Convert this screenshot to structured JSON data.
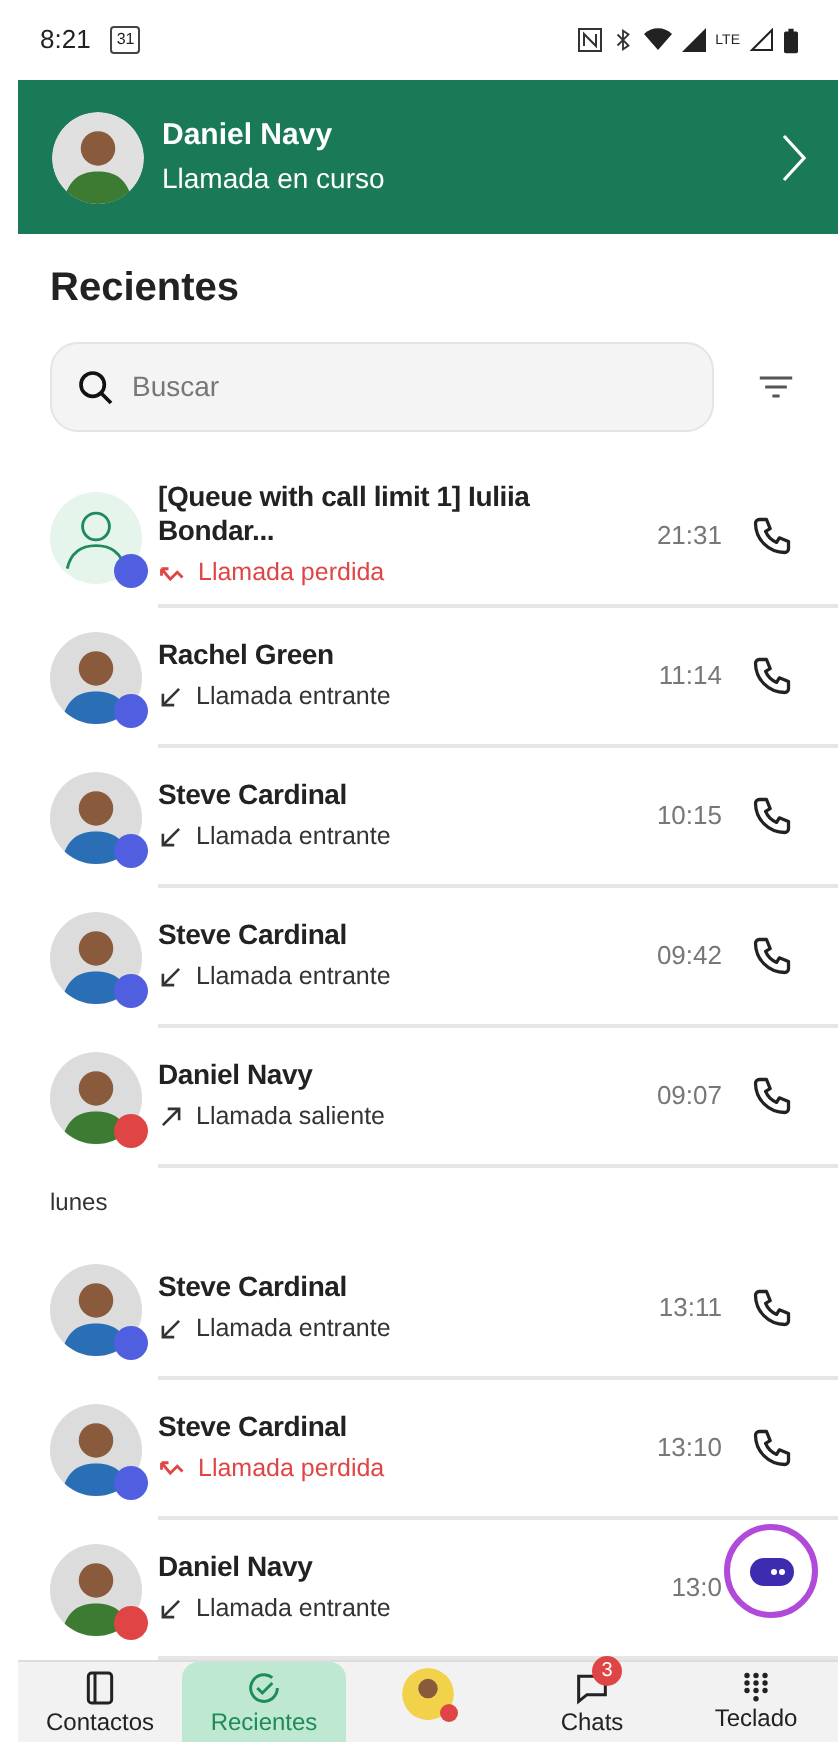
{
  "status_bar": {
    "time": "8:21",
    "calendar_badge": "31",
    "lte": "LTE"
  },
  "active_call": {
    "name": "Daniel Navy",
    "status": "Llamada en curso"
  },
  "title": "Recientes",
  "search": {
    "placeholder": "Buscar"
  },
  "sections": [
    {
      "items": [
        {
          "name": "[Queue with call limit 1] Iuliia Bondar...",
          "kind": "missed",
          "label": "Llamada perdida",
          "time": "21:31",
          "avatar": {
            "kind": "placeholder"
          },
          "color": "#4f5fe0",
          "call_button": true
        },
        {
          "name": "Rachel Green",
          "kind": "incoming",
          "label": "Llamada entrante",
          "time": "11:14",
          "color": "#4f5fe0",
          "call_button": true
        },
        {
          "name": "Steve Cardinal",
          "kind": "incoming",
          "label": "Llamada entrante",
          "time": "10:15",
          "color": "#4f5fe0",
          "call_button": true
        },
        {
          "name": "Steve Cardinal",
          "kind": "incoming",
          "label": "Llamada entrante",
          "time": "09:42",
          "color": "#4f5fe0",
          "call_button": true
        },
        {
          "name": "Daniel Navy",
          "kind": "outgoing",
          "label": "Llamada saliente",
          "time": "09:07",
          "color": "#e04545",
          "call_button": true
        }
      ]
    },
    {
      "header": "lunes",
      "items": [
        {
          "name": "Steve Cardinal",
          "kind": "incoming",
          "label": "Llamada entrante",
          "time": "13:11",
          "color": "#4f5fe0",
          "call_button": true
        },
        {
          "name": "Steve Cardinal",
          "kind": "missed",
          "label": "Llamada perdida",
          "time": "13:10",
          "color": "#4f5fe0",
          "call_button": true
        },
        {
          "name": "Daniel Navy",
          "kind": "incoming",
          "label": "Llamada entrante",
          "time": "13:0",
          "color": "#e04545",
          "call_button": false
        }
      ]
    }
  ],
  "bottom_nav": [
    {
      "kind": "contacts",
      "label": "Contactos",
      "selected": false
    },
    {
      "kind": "recents",
      "label": "Recientes",
      "selected": true
    },
    {
      "kind": "profile",
      "selected": false
    },
    {
      "kind": "chats",
      "label": "Chats",
      "badge": "3",
      "selected": false
    },
    {
      "kind": "keypad",
      "label": "Teclado",
      "selected": false
    }
  ]
}
